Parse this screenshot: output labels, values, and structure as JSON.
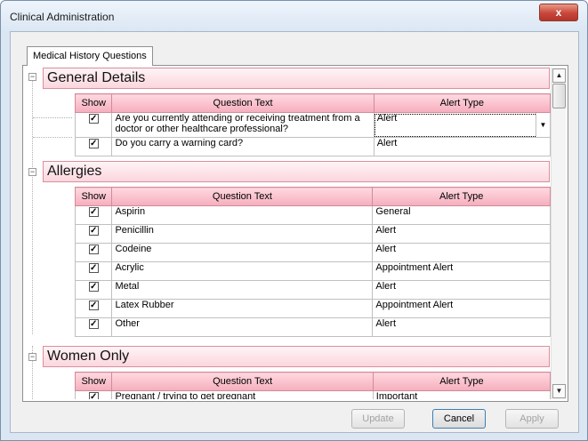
{
  "window": {
    "title": "Clinical Administration",
    "close_glyph": "x"
  },
  "tabs": [
    {
      "label": "Medical History Questions"
    }
  ],
  "columns": {
    "show": "Show",
    "question": "Question Text",
    "alert": "Alert Type"
  },
  "sections": [
    {
      "title": "General Details",
      "rows": [
        {
          "checked": true,
          "question": "Are you currently attending or receiving treatment from a doctor or other healthcare professional?",
          "alert": "Alert"
        },
        {
          "checked": true,
          "question": "Do you carry a warning card?",
          "alert": "Alert"
        }
      ]
    },
    {
      "title": "Allergies",
      "rows": [
        {
          "checked": true,
          "question": "Aspirin",
          "alert": "General"
        },
        {
          "checked": true,
          "question": "Penicillin",
          "alert": "Alert"
        },
        {
          "checked": true,
          "question": "Codeine",
          "alert": "Alert"
        },
        {
          "checked": true,
          "question": "Acrylic",
          "alert": "Appointment Alert"
        },
        {
          "checked": true,
          "question": "Metal",
          "alert": "Alert"
        },
        {
          "checked": true,
          "question": "Latex Rubber",
          "alert": "Appointment Alert"
        },
        {
          "checked": true,
          "question": "Other",
          "alert": "Alert"
        }
      ]
    },
    {
      "title": "Women Only",
      "rows": [
        {
          "checked": true,
          "question": "Pregnant / trying to get pregnant",
          "alert": "Important"
        }
      ]
    }
  ],
  "buttons": {
    "update": "Update",
    "cancel": "Cancel",
    "apply": "Apply"
  },
  "icons": {
    "expander": "collapse-minus-icon",
    "checkbox": "checkbox-checked-icon",
    "dropdown": "chevron-down-icon"
  },
  "colors": {
    "section_header": "#fbd6de",
    "grid_header": "#f5aebd",
    "close": "#c8463a"
  }
}
